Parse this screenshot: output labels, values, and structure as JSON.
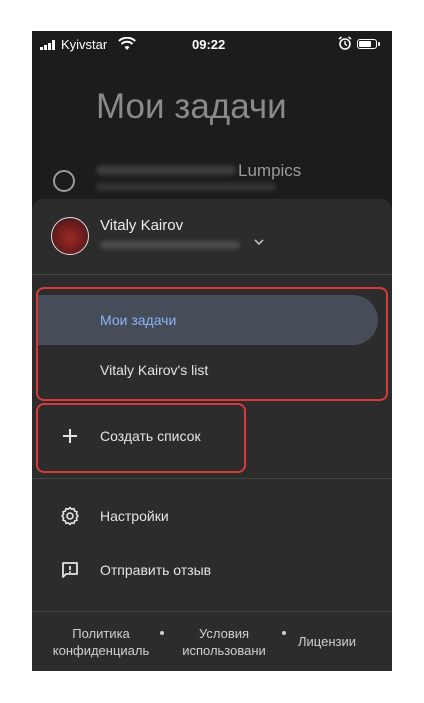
{
  "status_bar": {
    "carrier": "Kyivstar",
    "time": "09:22"
  },
  "background": {
    "title": "Мои задачи",
    "task_suffix": "Lumpics"
  },
  "account": {
    "name": "Vitaly Kairov"
  },
  "lists": [
    {
      "label": "Мои задачи",
      "active": true
    },
    {
      "label": "Vitaly Kairov's list",
      "active": false
    }
  ],
  "actions": {
    "create_list": "Создать список",
    "settings": "Настройки",
    "feedback": "Отправить отзыв"
  },
  "footer": {
    "privacy_line1": "Политика",
    "privacy_line2": "конфиденциаль",
    "terms_line1": "Условия",
    "terms_line2": "использовани",
    "licenses": "Лицензии"
  },
  "colors": {
    "background": "#1c1c1c",
    "drawer": "#2c2c2c",
    "active_item": "#474c59",
    "accent": "#8ab4f8",
    "highlight_border": "#d83a3a"
  }
}
